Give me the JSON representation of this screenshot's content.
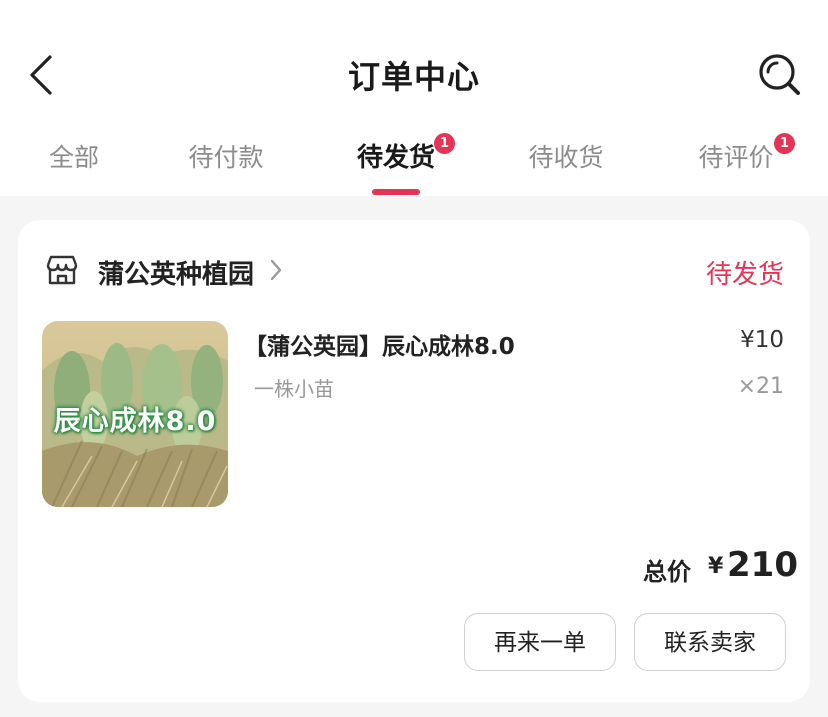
{
  "header": {
    "title": "订单中心",
    "back_icon": "chevron-left-icon",
    "search_icon": "search-icon"
  },
  "tabs": [
    {
      "label": "全部",
      "active": false,
      "badge": ""
    },
    {
      "label": "待付款",
      "active": false,
      "badge": ""
    },
    {
      "label": "待发货",
      "active": true,
      "badge": "1"
    },
    {
      "label": "待收货",
      "active": false,
      "badge": ""
    },
    {
      "label": "待评价",
      "active": false,
      "badge": "1"
    }
  ],
  "order": {
    "shop_icon": "store-icon",
    "shop_name": "蒲公英种植园",
    "status": "待发货",
    "product": {
      "thumbnail_text": "辰心成林8.0",
      "title": "【蒲公英园】辰心成林8.0",
      "variant": "一株小苗",
      "price": "¥10",
      "quantity": "×21"
    },
    "total_label": "总价",
    "total_currency": "¥",
    "total_amount": "210",
    "actions": {
      "reorder": "再来一单",
      "contact": "联系卖家"
    }
  },
  "colors": {
    "accent": "#e63456",
    "background": "#f5f5f5",
    "card": "#ffffff"
  }
}
